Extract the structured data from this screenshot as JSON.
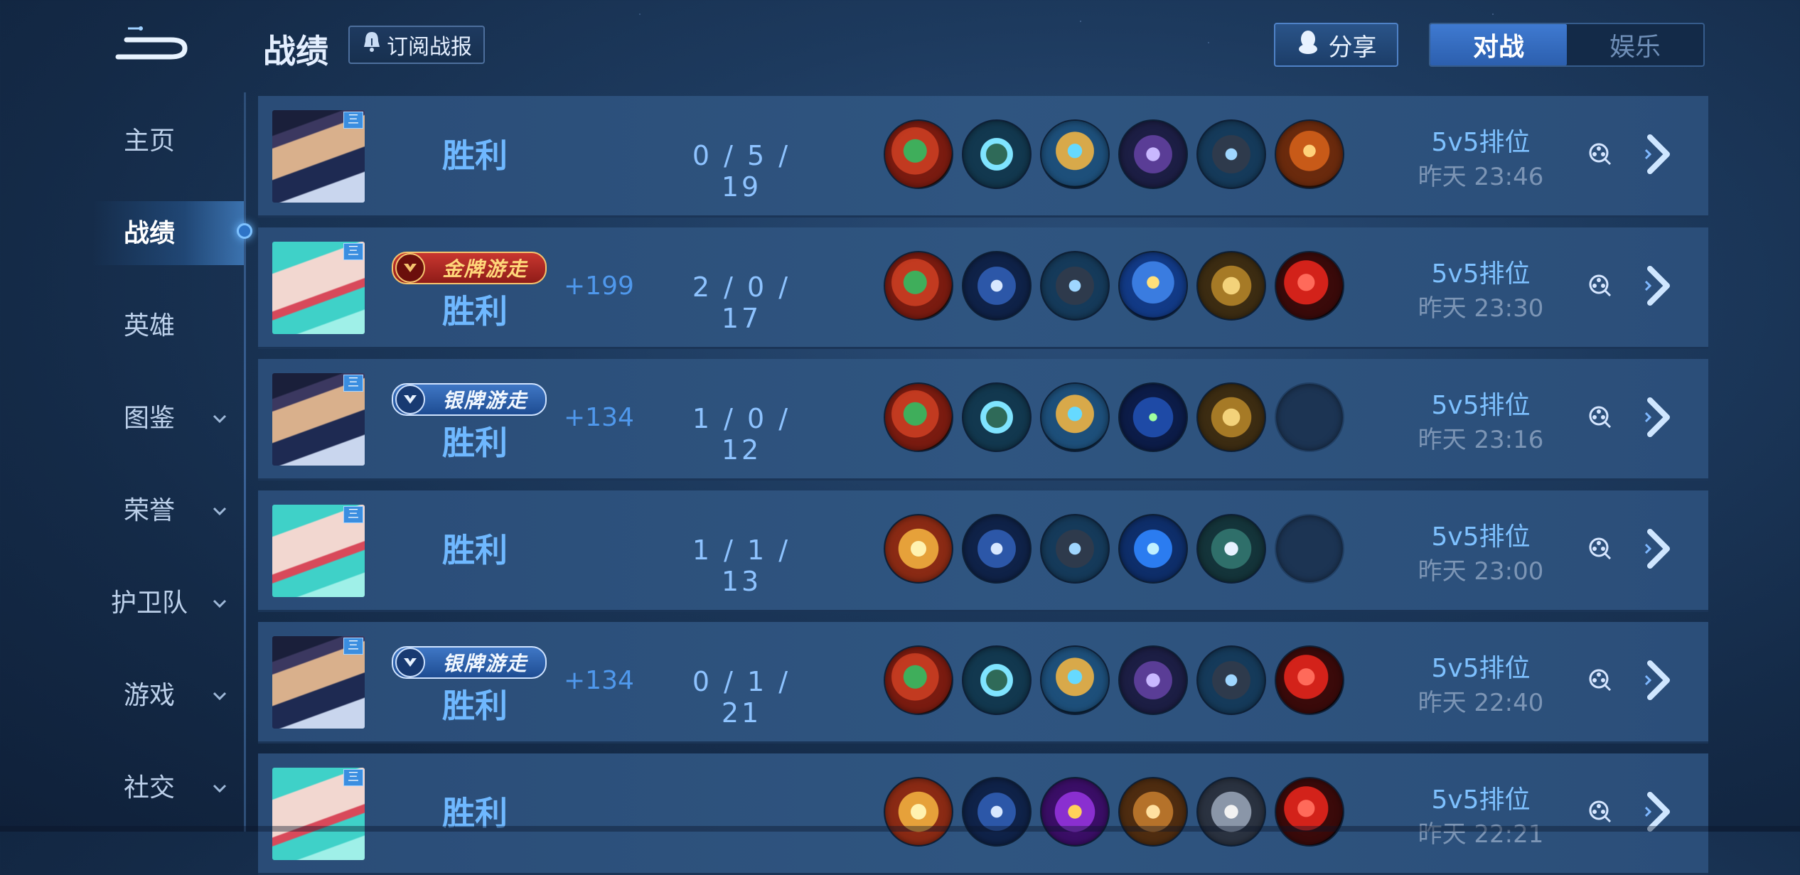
{
  "header": {
    "title": "战绩",
    "subscribe_label": "订阅战报",
    "share_label": "分享",
    "tabs": [
      {
        "label": "对战",
        "active": true
      },
      {
        "label": "娱乐",
        "active": false
      }
    ]
  },
  "sidebar": {
    "items": [
      {
        "label": "主页",
        "has_chevron": false,
        "active": false
      },
      {
        "label": "战绩",
        "has_chevron": false,
        "active": true
      },
      {
        "label": "英雄",
        "has_chevron": false,
        "active": false
      },
      {
        "label": "图鉴",
        "has_chevron": true,
        "active": false
      },
      {
        "label": "荣誉",
        "has_chevron": true,
        "active": false
      },
      {
        "label": "护卫队",
        "has_chevron": true,
        "active": false
      },
      {
        "label": "游戏",
        "has_chevron": true,
        "active": false
      },
      {
        "label": "社交",
        "has_chevron": true,
        "active": false
      }
    ]
  },
  "matches": [
    {
      "hero": "hero-male",
      "level_badge": "三",
      "medal": null,
      "medal_label": "",
      "result": "胜利",
      "points": "",
      "kda": "0 / 5 / 19",
      "items": [
        "green-jade-item-icon",
        "cyan-boots-icon",
        "gold-helm-icon",
        "purple-armor-icon",
        "dark-armor-icon",
        "orange-armor-icon"
      ],
      "mode": "5v5排位",
      "time": "昨天 23:46"
    },
    {
      "hero": "hero-female",
      "level_badge": "三",
      "medal": "gold",
      "medal_label": "金牌游走",
      "result": "胜利",
      "points": "+199",
      "kda": "2 / 0 / 17",
      "items": [
        "green-jade-item-icon",
        "blue-boots-icon",
        "dark-armor-icon",
        "blue-gold-armor-icon",
        "gold-skirt-icon",
        "red-gem-icon"
      ],
      "mode": "5v5排位",
      "time": "昨天 23:30"
    },
    {
      "hero": "hero-male",
      "level_badge": "三",
      "medal": "silver",
      "medal_label": "银牌游走",
      "result": "胜利",
      "points": "+134",
      "kda": "1 / 0 / 12",
      "items": [
        "green-jade-item-icon",
        "cyan-boots-icon",
        "gold-helm-icon",
        "blue-cloak-icon",
        "gold-skirt-icon",
        "empty-slot"
      ],
      "mode": "5v5排位",
      "time": "昨天 23:16"
    },
    {
      "hero": "hero-female",
      "level_badge": "三",
      "medal": null,
      "medal_label": "",
      "result": "胜利",
      "points": "",
      "kda": "1 / 1 / 13",
      "items": [
        "gold-wing-item-icon",
        "blue-boots-icon",
        "dark-armor-icon",
        "blue-orb-icon",
        "teal-scroll-icon",
        "empty-slot"
      ],
      "mode": "5v5排位",
      "time": "昨天 23:00"
    },
    {
      "hero": "hero-male",
      "level_badge": "三",
      "medal": "silver",
      "medal_label": "银牌游走",
      "result": "胜利",
      "points": "+134",
      "kda": "0 / 1 / 21",
      "items": [
        "green-jade-item-icon",
        "cyan-boots-icon",
        "gold-helm-icon",
        "purple-armor-icon",
        "dark-armor-icon",
        "red-gem-icon"
      ],
      "mode": "5v5排位",
      "time": "昨天 22:40"
    },
    {
      "hero": "hero-female",
      "level_badge": "三",
      "medal": null,
      "medal_label": "",
      "result": "胜利",
      "points": "",
      "kda": "",
      "items": [
        "gold-wing-item-icon",
        "blue-boots-icon",
        "purple-staff-icon",
        "bronze-armor-icon",
        "silver-armor-icon",
        "red-gem-icon"
      ],
      "mode": "5v5排位",
      "time": "昨天 22:21"
    }
  ]
}
